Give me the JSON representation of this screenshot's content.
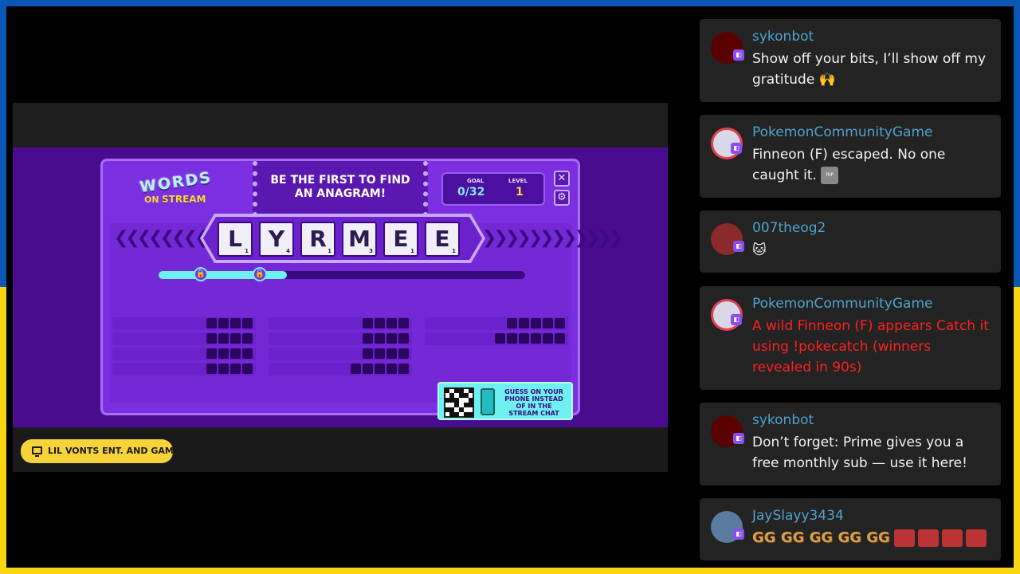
{
  "stream": {
    "game": {
      "logo_words": "WORDS",
      "logo_on": "ON",
      "logo_stream": "STREAM",
      "headline_line1": "BE THE FIRST TO FIND",
      "headline_line2": "AN ANAGRAM!",
      "goal_label": "GOAL",
      "goal_value": "0/32",
      "level_label": "LEVEL",
      "level_value": "1",
      "close_glyph": "✕",
      "settings_glyph": "⚙",
      "tiles": [
        {
          "letter": "L",
          "points": "1"
        },
        {
          "letter": "Y",
          "points": "4"
        },
        {
          "letter": "R",
          "points": "1"
        },
        {
          "letter": "M",
          "points": "3"
        },
        {
          "letter": "E",
          "points": "1"
        },
        {
          "letter": "E",
          "points": "1"
        }
      ],
      "progress_fraction": 0.35,
      "lock_glyph": "🔒",
      "qr_line1": "GUESS ON YOUR",
      "qr_line2": "PHONE INSTEAD",
      "qr_line3": "OF IN THE",
      "qr_line4": "STREAM CHAT",
      "colors": {
        "board": "#7b2fe0",
        "accent_cyan": "#6ff0f0",
        "accent_yellow": "#ffd438"
      }
    },
    "channel_badge": "LIL VONTS ENT. AND GAMING"
  },
  "chat": [
    {
      "username": "sykonbot",
      "message": "Show off your bits, I’ll show off my gratitude 🙌"
    },
    {
      "username": "PokemonCommunityGame",
      "message": "Finneon (F) escaped. No one caught it.",
      "emote": "RIP"
    },
    {
      "username": "007theog2",
      "message": "🐱"
    },
    {
      "username": "PokemonCommunityGame",
      "message": "A wild Finneon (F) appears Catch it using !pokecatch (winners revealed in 90s)",
      "color": "#ff2020"
    },
    {
      "username": "sykonbot",
      "message": "Don’t forget: Prime gives you a free monthly sub — use it here!"
    },
    {
      "username": "JaySlayy3434",
      "message": "GG GG GG GG GG"
    }
  ],
  "flag_colors": {
    "blue": "#0b57b5",
    "yellow": "#f7d511"
  }
}
